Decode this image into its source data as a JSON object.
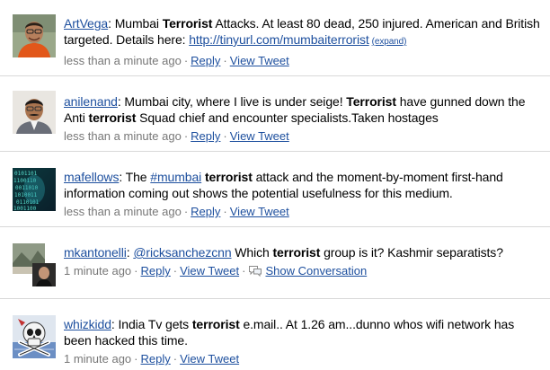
{
  "tweets": [
    {
      "user": "ArtVega",
      "parts": [
        ": Mumbai ",
        "Terrorist",
        " Attacks. At least 80 dead, 250 injured. American and British targeted. Details here: "
      ],
      "link": "http://tinyurl.com/mumbaiterrorist",
      "expand": "(expand)",
      "time": "less than a minute ago",
      "reply": "Reply",
      "view": "View Tweet",
      "avatar_icon": "person-orange-shirt-avatar"
    },
    {
      "user": "anilenand",
      "parts": [
        ": Mumbai city, where I live is under seige! ",
        "Terrorist",
        " have gunned down the Anti ",
        "terrorist",
        " Squad chief and encounter specialists.Taken hostages"
      ],
      "time": "less than a minute ago",
      "reply": "Reply",
      "view": "View Tweet",
      "avatar_icon": "man-with-mustache-avatar"
    },
    {
      "user": "mafellows",
      "parts": [
        ": The ",
        "#mumbai",
        " ",
        "terrorist",
        " attack and the moment-by-moment first-hand information coming out shows the potential usefulness for this medium."
      ],
      "time": "less than a minute ago",
      "reply": "Reply",
      "view": "View Tweet",
      "avatar_icon": "binary-matrix-avatar"
    },
    {
      "user": "mkantonelli",
      "parts": [
        ": ",
        "@ricksanchezcnn",
        " Which ",
        "terrorist",
        " group is it? Kashmir separatists?"
      ],
      "time": "1 minute ago",
      "reply": "Reply",
      "view": "View Tweet",
      "conversation": "Show Conversation",
      "avatar_icon": "landscape-avatar"
    },
    {
      "user": "whizkidd",
      "parts": [
        ": India Tv gets ",
        "terrorist",
        " e.mail.. At 1.26 am...dunno whos wifi network has been hacked this time."
      ],
      "time": "1 minute ago",
      "reply": "Reply",
      "view": "View Tweet",
      "avatar_icon": "skull-crossbones-avatar"
    }
  ],
  "separator": "·",
  "colors": {
    "link": "#1d4f9e",
    "meta": "#777777",
    "divider": "#d8d8d8"
  }
}
